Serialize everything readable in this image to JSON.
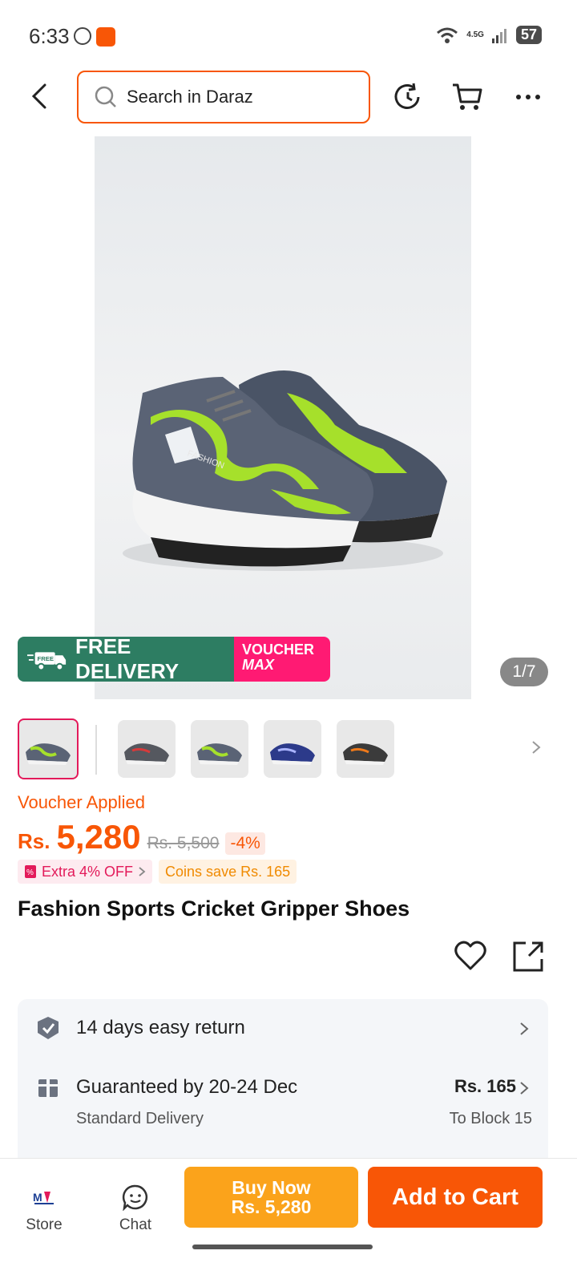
{
  "status_bar": {
    "time": "6:33",
    "battery": "57",
    "network": "4.5G"
  },
  "header": {
    "search_placeholder": "Search in Daraz"
  },
  "gallery": {
    "promo_free_delivery": "FREE DELIVERY",
    "promo_free_tag": "FREE",
    "promo_voucher_line1": "VOUCHER",
    "promo_voucher_line2": "MAX",
    "page_counter": "1/7",
    "shoe_brand_text": "FASHION"
  },
  "product": {
    "voucher_status": "Voucher Applied",
    "currency": "Rs.",
    "price": "5,280",
    "original_price": "Rs. 5,500",
    "discount": "-4%",
    "extra_off": "Extra 4% OFF",
    "coins_save": "Coins save Rs. 165",
    "title": "Fashion Sports Cricket Gripper Shoes"
  },
  "info": {
    "return_policy": "14 days easy return",
    "delivery_guarantee": "Guaranteed by 20-24 Dec",
    "delivery_type": "Standard Delivery",
    "delivery_fee": "Rs. 165",
    "delivery_location": "To Block 15"
  },
  "bottom_bar": {
    "store_label": "Store",
    "chat_label": "Chat",
    "buy_now_label": "Buy Now",
    "buy_now_price": "Rs. 5,280",
    "add_to_cart_label": "Add to Cart"
  },
  "colors": {
    "accent": "#f85606",
    "buy_now": "#fba31b",
    "voucher_pink": "#ff1a73",
    "delivery_green": "#2d7d62"
  }
}
